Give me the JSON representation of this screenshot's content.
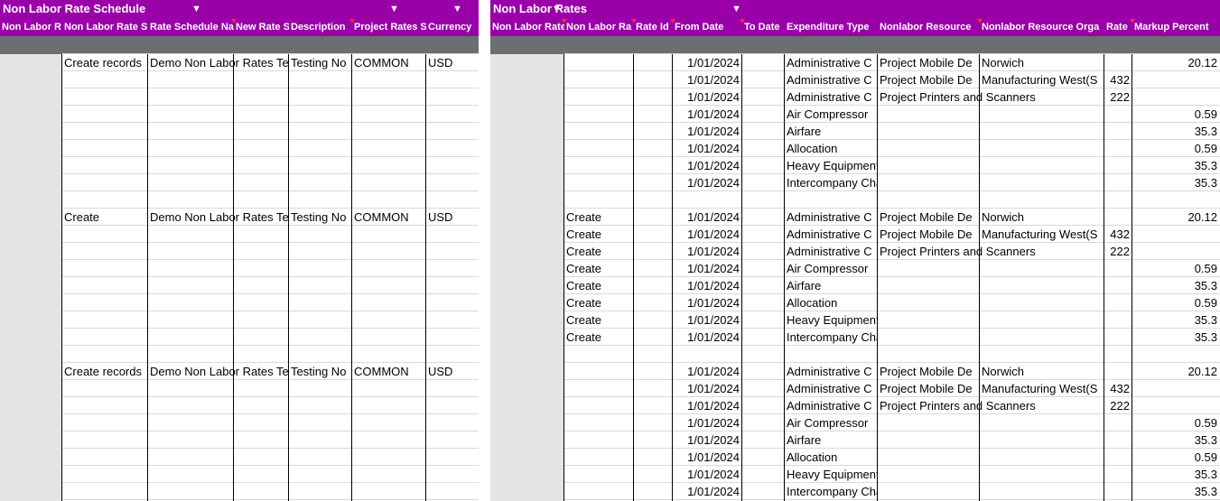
{
  "left_panel": {
    "title": "Non Labor Rate Schedule",
    "headers": [
      "Non Labor R",
      "Non Labor Rate S",
      "Rate Schedule Na",
      "New Rate S",
      "Description",
      "Project Rates S",
      "Currency"
    ],
    "blocks": [
      {
        "action": "Create records",
        "schedule": "Demo Non Labor Rates Te",
        "description": "Testing No",
        "project_rates": "COMMON",
        "currency": "USD"
      },
      {
        "action": "Create",
        "schedule": "Demo Non Labor Rates Te",
        "description": "Testing No",
        "project_rates": "COMMON",
        "currency": "USD"
      },
      {
        "action": "Create records",
        "schedule": "Demo Non Labor Rates Te",
        "description": "Testing No",
        "project_rates": "COMMON",
        "currency": "USD"
      }
    ]
  },
  "right_panel": {
    "title": "Non Labor Rates",
    "headers": [
      "Non Labor Rate",
      "Non Labor Ra",
      "Rate Id",
      "From Date",
      "To Date",
      "Expenditure Type",
      "Nonlabor Resource",
      "Nonlabor Resource Orga",
      "Rate",
      "Markup Percent"
    ],
    "blocks": [
      {
        "rows": [
          {
            "action": "",
            "from": "1/01/2024",
            "exp": "Administrative C",
            "res": "Project Mobile De",
            "org": "Norwich",
            "rate": "",
            "markup": "20.12"
          },
          {
            "action": "",
            "from": "1/01/2024",
            "exp": "Administrative C",
            "res": "Project Mobile De",
            "org": "Manufacturing West(S",
            "rate": "432",
            "markup": ""
          },
          {
            "action": "",
            "from": "1/01/2024",
            "exp": "Administrative C",
            "res": "Project Printers and Scanners",
            "org": "",
            "rate": "222",
            "markup": ""
          },
          {
            "action": "",
            "from": "1/01/2024",
            "exp": "Air Compressor",
            "res": "",
            "org": "",
            "rate": "",
            "markup": "0.59"
          },
          {
            "action": "",
            "from": "1/01/2024",
            "exp": "Airfare",
            "res": "",
            "org": "",
            "rate": "",
            "markup": "35.3"
          },
          {
            "action": "",
            "from": "1/01/2024",
            "exp": "Allocation",
            "res": "",
            "org": "",
            "rate": "",
            "markup": "0.59"
          },
          {
            "action": "",
            "from": "1/01/2024",
            "exp": "Heavy Equipment.Crane",
            "res": "",
            "org": "",
            "rate": "",
            "markup": "35.3"
          },
          {
            "action": "",
            "from": "1/01/2024",
            "exp": "Intercompany Charge",
            "res": "",
            "org": "",
            "rate": "",
            "markup": "35.3"
          }
        ]
      },
      {
        "rows": [
          {
            "action": "Create",
            "from": "1/01/2024",
            "exp": "Administrative C",
            "res": "Project Mobile De",
            "org": "Norwich",
            "rate": "",
            "markup": "20.12"
          },
          {
            "action": "Create",
            "from": "1/01/2024",
            "exp": "Administrative C",
            "res": "Project Mobile De",
            "org": "Manufacturing West(S",
            "rate": "432",
            "markup": ""
          },
          {
            "action": "Create",
            "from": "1/01/2024",
            "exp": "Administrative C",
            "res": "Project Printers and Scanners",
            "org": "",
            "rate": "222",
            "markup": ""
          },
          {
            "action": "Create",
            "from": "1/01/2024",
            "exp": "Air Compressor",
            "res": "",
            "org": "",
            "rate": "",
            "markup": "0.59"
          },
          {
            "action": "Create",
            "from": "1/01/2024",
            "exp": "Airfare",
            "res": "",
            "org": "",
            "rate": "",
            "markup": "35.3"
          },
          {
            "action": "Create",
            "from": "1/01/2024",
            "exp": "Allocation",
            "res": "",
            "org": "",
            "rate": "",
            "markup": "0.59"
          },
          {
            "action": "Create",
            "from": "1/01/2024",
            "exp": "Heavy Equipment.Crane",
            "res": "",
            "org": "",
            "rate": "",
            "markup": "35.3"
          },
          {
            "action": "Create",
            "from": "1/01/2024",
            "exp": "Intercompany Charge",
            "res": "",
            "org": "",
            "rate": "",
            "markup": "35.3"
          }
        ]
      },
      {
        "rows": [
          {
            "action": "",
            "from": "1/01/2024",
            "exp": "Administrative C",
            "res": "Project Mobile De",
            "org": "Norwich",
            "rate": "",
            "markup": "20.12"
          },
          {
            "action": "",
            "from": "1/01/2024",
            "exp": "Administrative C",
            "res": "Project Mobile De",
            "org": "Manufacturing West(S",
            "rate": "432",
            "markup": ""
          },
          {
            "action": "",
            "from": "1/01/2024",
            "exp": "Administrative C",
            "res": "Project Printers and Scanners",
            "org": "",
            "rate": "222",
            "markup": ""
          },
          {
            "action": "",
            "from": "1/01/2024",
            "exp": "Air Compressor",
            "res": "",
            "org": "",
            "rate": "",
            "markup": "0.59"
          },
          {
            "action": "",
            "from": "1/01/2024",
            "exp": "Airfare",
            "res": "",
            "org": "",
            "rate": "",
            "markup": "35.3"
          },
          {
            "action": "",
            "from": "1/01/2024",
            "exp": "Allocation",
            "res": "",
            "org": "",
            "rate": "",
            "markup": "0.59"
          },
          {
            "action": "",
            "from": "1/01/2024",
            "exp": "Heavy Equipment.Crane",
            "res": "",
            "org": "",
            "rate": "",
            "markup": "35.3"
          },
          {
            "action": "",
            "from": "1/01/2024",
            "exp": "Intercompany Charge",
            "res": "",
            "org": "",
            "rate": "",
            "markup": "35.3"
          }
        ]
      }
    ]
  },
  "filter_icon": "filter-dropdown-icon",
  "colors": {
    "header_bg": "#9900a8",
    "band_gray": "#6b6e72",
    "indicator_red": "#ff2b2b"
  }
}
